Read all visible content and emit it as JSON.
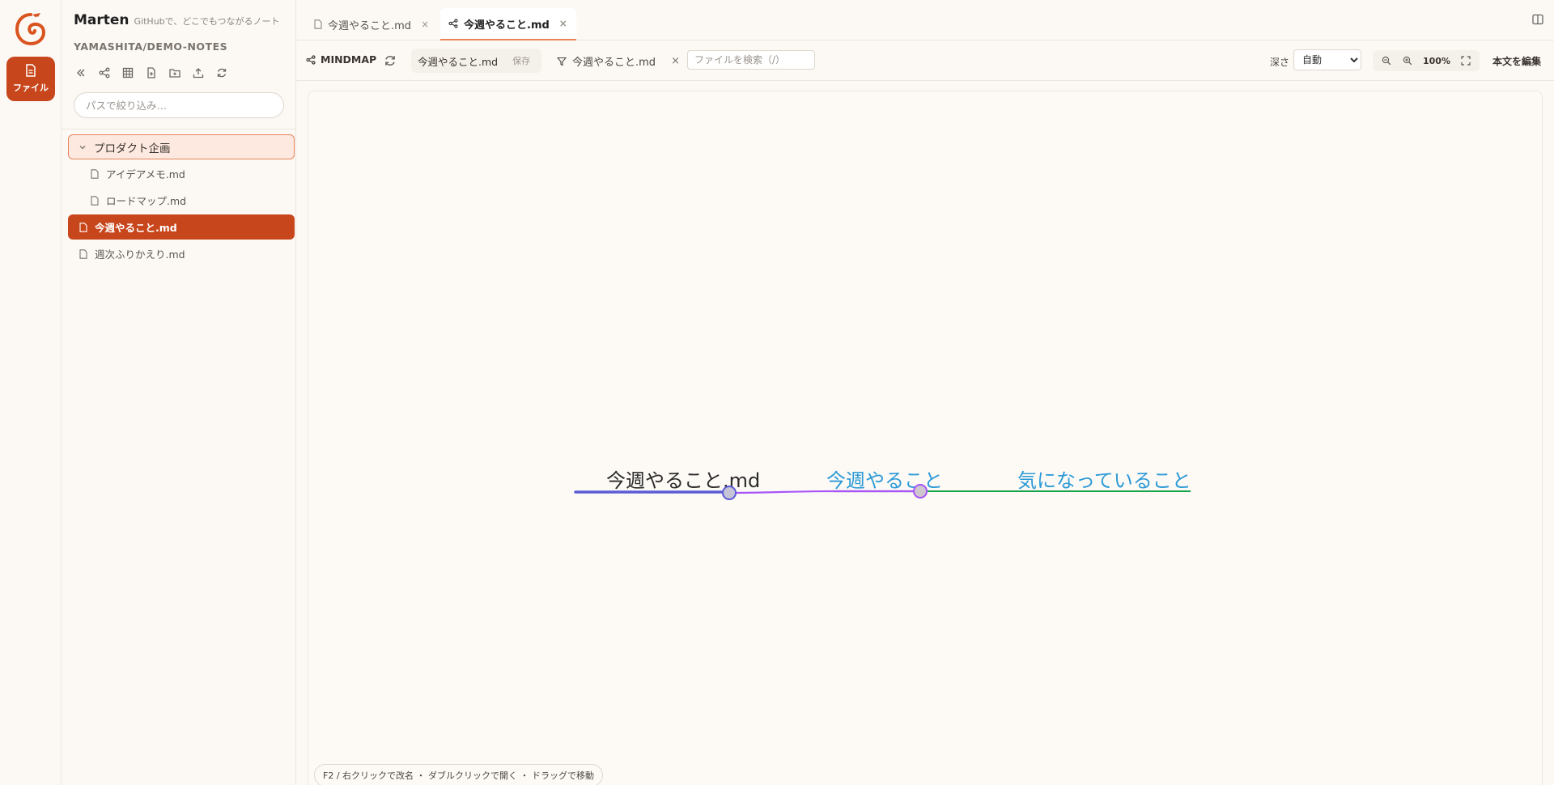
{
  "app": {
    "rail_files_label": "ファイル",
    "name": "Marten",
    "tagline": "GitHubで、どこでもつながるノート",
    "repo": "YAMASHITA/DEMO-NOTES"
  },
  "sidebar": {
    "filter_placeholder": "パスで絞り込み…",
    "tree": {
      "folder": "プロダクト企画",
      "folder_children": [
        "アイデアメモ.md",
        "ロードマップ.md"
      ],
      "active_file": "今週やること.md",
      "other_file": "週次ふりかえり.md"
    }
  },
  "tabs": [
    {
      "label": "今週やること.md",
      "type": "file"
    },
    {
      "label": "今週やること.md",
      "type": "mindmap",
      "active": true
    }
  ],
  "toolbar": {
    "mode_label": "MINDMAP",
    "file_name": "今週やること.md",
    "save_label": "保存",
    "filter_label": "今週やること.md",
    "search_placeholder": "ファイルを検索（/）",
    "depth_label": "深さ",
    "depth_value": "自動",
    "zoom_level": "100%",
    "edit_label": "本文を編集"
  },
  "mindmap": {
    "nodes": [
      {
        "label": "今週やること.md",
        "color": "#5b5bd6",
        "level": 0
      },
      {
        "label": "今週やること",
        "color": "#a855f7",
        "level": 1
      },
      {
        "label": "気になっていること",
        "color": "#16a34a",
        "level": 2
      }
    ],
    "text_colors": {
      "root": "#2b2b2b",
      "child": "#2d9ad6"
    }
  },
  "hint": "F2 / 右クリックで改名 ・ ダブルクリックで開く ・ ドラッグで移動",
  "colors": {
    "accent": "#c8461c",
    "background": "#fcf9f5",
    "folder_highlight": "#fde9df"
  }
}
